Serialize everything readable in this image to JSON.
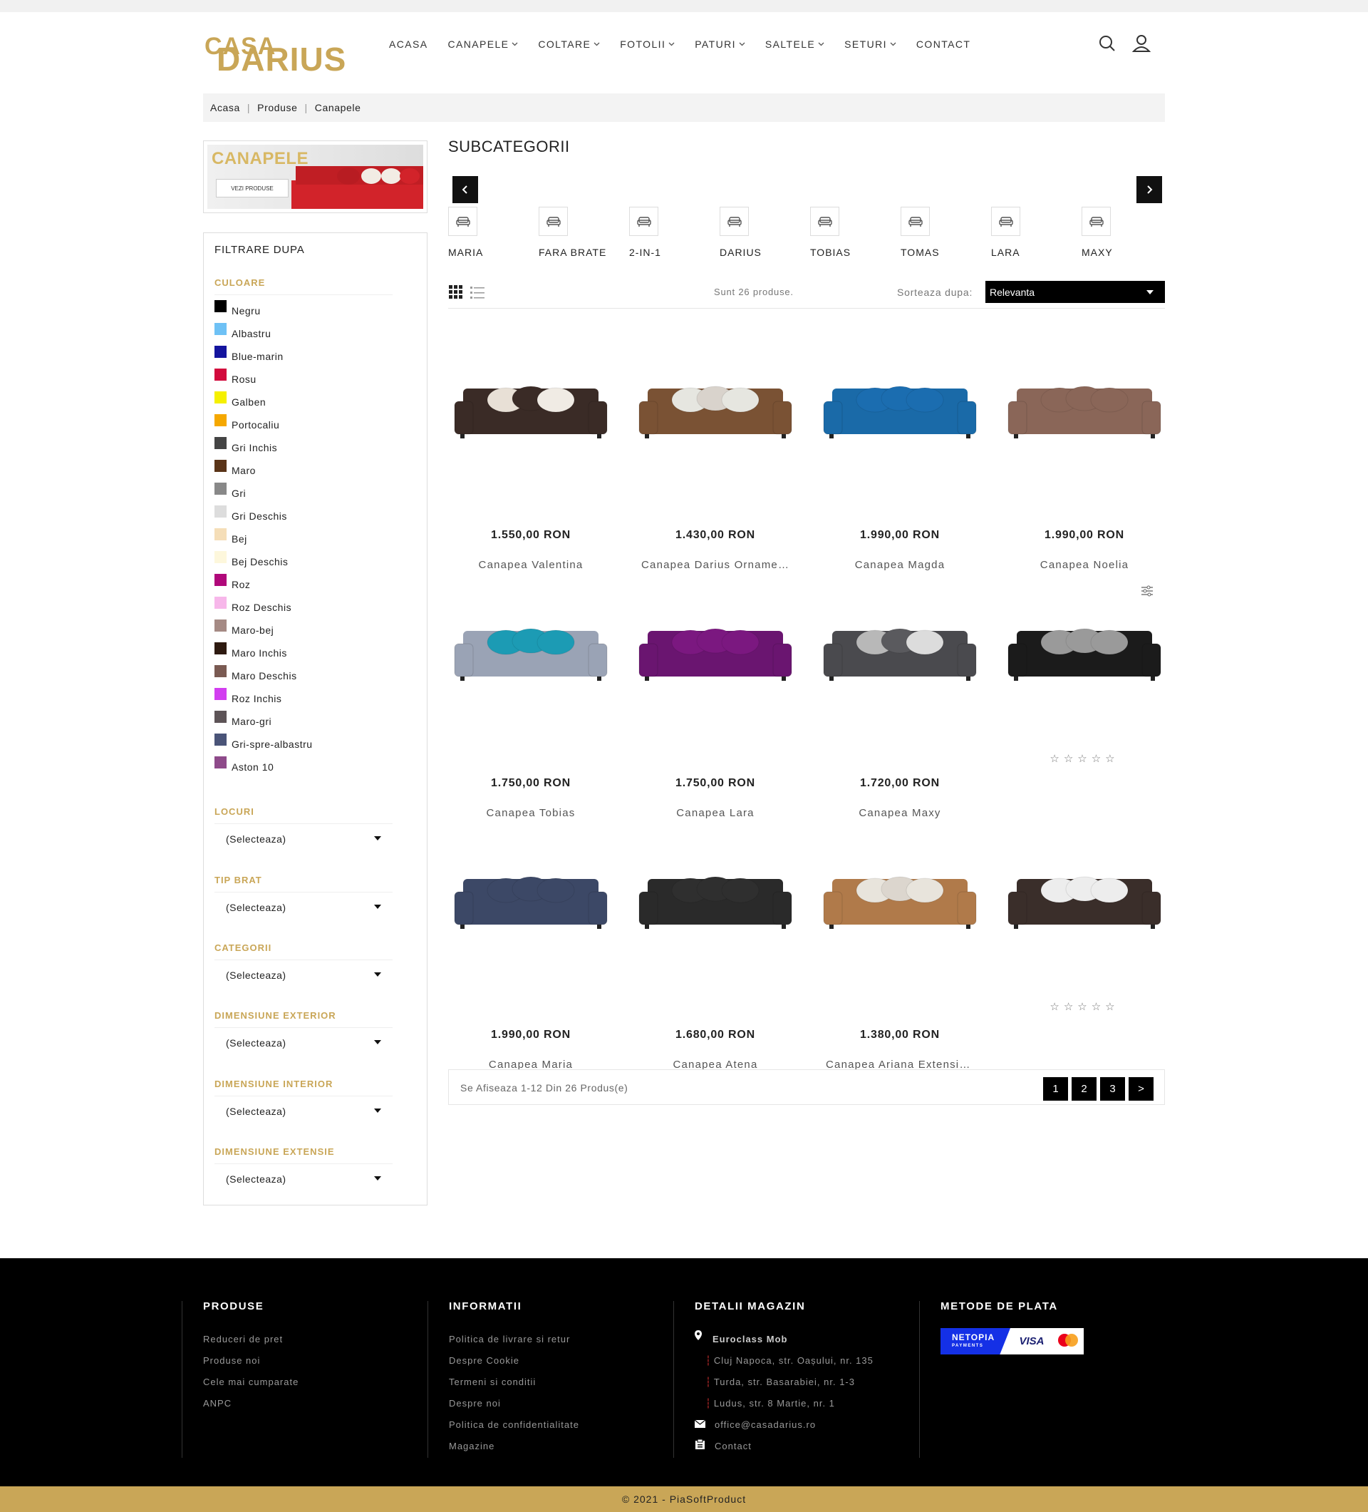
{
  "brand": {
    "line1": "CASA",
    "line2": "DARIUS",
    "color": "#c9a657"
  },
  "nav": [
    {
      "label": "ACASA",
      "chev": false
    },
    {
      "label": "CANAPELE",
      "chev": true
    },
    {
      "label": "COLTARE",
      "chev": true
    },
    {
      "label": "FOTOLII",
      "chev": true
    },
    {
      "label": "PATURI",
      "chev": true
    },
    {
      "label": "SALTELE",
      "chev": true
    },
    {
      "label": "SETURI",
      "chev": true
    },
    {
      "label": "CONTACT",
      "chev": false
    }
  ],
  "header_icons": [
    "search-icon",
    "user-icon"
  ],
  "breadcrumb": [
    "Acasa",
    "Produse",
    "Canapele"
  ],
  "banner": {
    "title": "CANAPELE",
    "button": "VEZI PRODUSE"
  },
  "filter": {
    "title": "FILTRARE DUPA",
    "color_section": "CULOARE",
    "colors": [
      {
        "label": "Negru",
        "hex": "#000000"
      },
      {
        "label": "Albastru",
        "hex": "#6ec1f5"
      },
      {
        "label": "Blue-marin",
        "hex": "#14149e"
      },
      {
        "label": "Rosu",
        "hex": "#d20a3c"
      },
      {
        "label": "Galben",
        "hex": "#f5f000"
      },
      {
        "label": "Portocaliu",
        "hex": "#f5a800"
      },
      {
        "label": "Gri Inchis",
        "hex": "#444444"
      },
      {
        "label": "Maro",
        "hex": "#5a3418"
      },
      {
        "label": "Gri",
        "hex": "#888888"
      },
      {
        "label": "Gri Deschis",
        "hex": "#dddddd"
      },
      {
        "label": "Bej",
        "hex": "#f5deb8"
      },
      {
        "label": "Bej Deschis",
        "hex": "#fdf7dc"
      },
      {
        "label": "Roz",
        "hex": "#b0087a"
      },
      {
        "label": "Roz Deschis",
        "hex": "#f7b7ea"
      },
      {
        "label": "Maro-bej",
        "hex": "#a58a84"
      },
      {
        "label": "Maro Inchis",
        "hex": "#2e1a10"
      },
      {
        "label": "Maro Deschis",
        "hex": "#7a5a52"
      },
      {
        "label": "Roz Inchis",
        "hex": "#d23ef0"
      },
      {
        "label": "Maro-gri",
        "hex": "#5d5457"
      },
      {
        "label": "Gri-spre-albastru",
        "hex": "#4a5478"
      },
      {
        "label": "Aston 10",
        "hex": "#8e4a8a"
      }
    ],
    "selects": [
      {
        "section": "LOCURI",
        "value": "(Selecteaza)"
      },
      {
        "section": "TIP BRAT",
        "value": "(Selecteaza)"
      },
      {
        "section": "CATEGORII",
        "value": "(Selecteaza)"
      },
      {
        "section": "DIMENSIUNE EXTERIOR",
        "value": "(Selecteaza)"
      },
      {
        "section": "DIMENSIUNE INTERIOR",
        "value": "(Selecteaza)"
      },
      {
        "section": "DIMENSIUNE EXTENSIE",
        "value": "(Selecteaza)"
      }
    ]
  },
  "subcategories": {
    "title": "SUBCATEGORII",
    "items": [
      "MARIA",
      "FARA BRATE",
      "2-IN-1",
      "DARIUS",
      "TOBIAS",
      "TOMAS",
      "LARA",
      "MAXY"
    ]
  },
  "toolbar": {
    "count": "Sunt 26 produse.",
    "sort_label": "Sorteaza dupa:",
    "sort_value": "Relevanta"
  },
  "products": [
    {
      "name": "Canapea Valentina",
      "price": "1.550,00 RON",
      "stars": false,
      "body": "#3a2b26",
      "pillows": [
        "#e8e0d6",
        "#3a2b26",
        "#f0ebe4"
      ]
    },
    {
      "name": "Canapea Darius Ornamente",
      "price": "1.430,00 RON",
      "stars": false,
      "body": "#7a5234",
      "pillows": [
        "#e6e6e0",
        "#d9d3cc",
        "#e6e6e0"
      ]
    },
    {
      "name": "Canapea Magda",
      "price": "1.990,00 RON",
      "stars": false,
      "body": "#1a6aa8",
      "pillows": [
        "#1b6db0",
        "#1b6db0",
        "#1b6db0"
      ]
    },
    {
      "name": "Canapea Noelia",
      "price": "1.990,00 RON",
      "stars": false,
      "body": "#8a6658",
      "pillows": [
        "#8a6658",
        "#8a6658",
        "#8a6658"
      ]
    },
    {
      "name": "Canapea Tobias",
      "price": "1.750,00 RON",
      "stars": false,
      "body": "#9aa3b5",
      "pillows": [
        "#1c9bb4",
        "#1c9bb4",
        "#1c9bb4"
      ]
    },
    {
      "name": "Canapea Lara",
      "price": "1.750,00 RON",
      "stars": false,
      "body": "#6a1570",
      "pillows": [
        "#7b1880",
        "#7b1880",
        "#7b1880"
      ]
    },
    {
      "name": "Canapea Maxy",
      "price": "1.720,00 RON",
      "stars": false,
      "body": "#4a4a4e",
      "pillows": [
        "#b8b8b8",
        "#5a5a5e",
        "#dcdcdc"
      ]
    },
    {
      "name": "",
      "price": "",
      "stars": true,
      "body": "#1b1b1b",
      "pillows": [
        "#9a9a9a",
        "#9a9a9a",
        "#9a9a9a"
      ]
    },
    {
      "name": "Canapea Maria",
      "price": "1.990,00 RON",
      "stars": false,
      "body": "#3c4866",
      "pillows": [
        "#3c4866",
        "#3c4866",
        "#3c4866"
      ]
    },
    {
      "name": "Canapea Atena",
      "price": "1.680,00 RON",
      "stars": false,
      "body": "#2a2a2a",
      "pillows": [
        "#2f2f2f",
        "#2f2f2f",
        "#2f2f2f"
      ]
    },
    {
      "name": "Canapea Ariana Extensibila",
      "price": "1.380,00 RON",
      "stars": false,
      "body": "#b07a4a",
      "pillows": [
        "#e8e4dc",
        "#dcd6ce",
        "#e8e4dc"
      ]
    },
    {
      "name": "",
      "price": "",
      "stars": true,
      "body": "#3a2e2a",
      "pillows": [
        "#ededed",
        "#ededed",
        "#ededed"
      ]
    }
  ],
  "pagination": {
    "text": "Se Afiseaza 1-12 Din 26 Produs(e)",
    "pages": [
      "1",
      "2",
      "3",
      ">"
    ]
  },
  "footer": {
    "produse": {
      "title": "PRODUSE",
      "links": [
        "Reduceri de pret",
        "Produse noi",
        "Cele mai cumparate",
        "ANPC"
      ]
    },
    "informatii": {
      "title": "INFORMATII",
      "links": [
        "Politica de livrare si retur",
        "Despre Cookie",
        "Termeni si conditii",
        "Despre noi",
        "Politica de confidentialitate",
        "Magazine"
      ]
    },
    "magazin": {
      "title": "DETALII MAGAZIN",
      "company": "Euroclass Mob",
      "addresses": [
        "Cluj Napoca, str. Oașului, nr. 135",
        "Turda, str. Basarabiei, nr. 1-3",
        "Ludus, str. 8 Martie, nr. 1"
      ],
      "email": "office@casadarius.ro",
      "contact": "Contact"
    },
    "plata": {
      "title": "METODE DE PLATA",
      "netopia": "NETOPIA",
      "netopia_sub": "PAYMENTS",
      "visa": "VISA"
    },
    "copyright": "© 2021 - PiaSoftProduct"
  }
}
